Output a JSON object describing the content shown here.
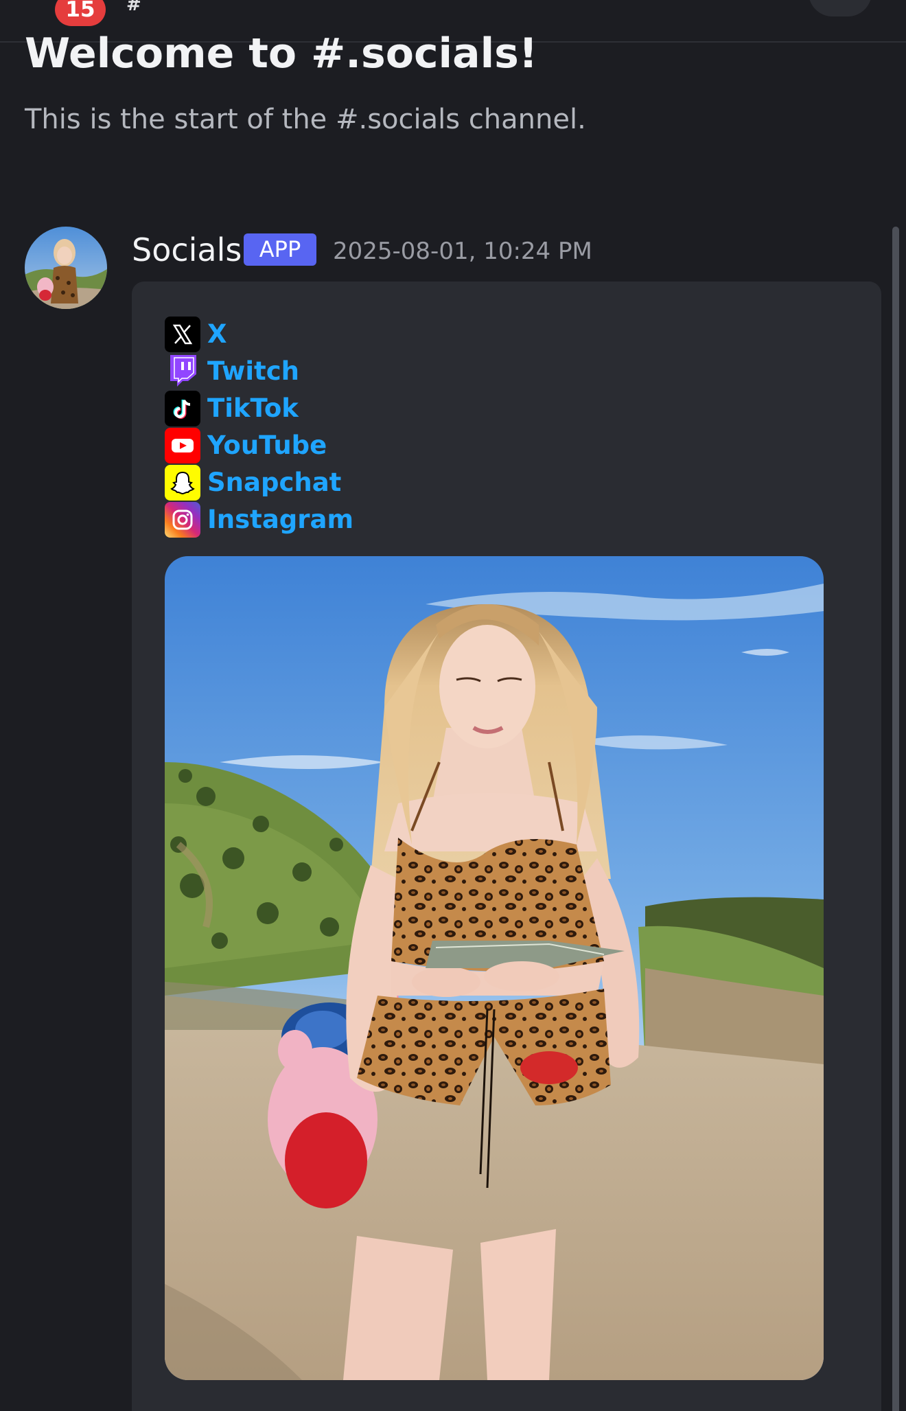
{
  "topbar": {
    "unread_count": "15",
    "channel_hash": "#"
  },
  "welcome": {
    "title": "Welcome to #.socials!",
    "subtitle": "This is the start of the #.socials channel."
  },
  "message": {
    "author": "Socials",
    "tag": "APP",
    "timestamp": "2025-08-01, 10:24 PM",
    "avatar_icon": "avatar-photo"
  },
  "embed": {
    "links": [
      {
        "label": "X",
        "icon": "x-logo-icon",
        "color": "#000000"
      },
      {
        "label": "Twitch",
        "icon": "twitch-logo-icon",
        "color": "#9146ff"
      },
      {
        "label": "TikTok",
        "icon": "tiktok-logo-icon",
        "color": "#000000"
      },
      {
        "label": "YouTube",
        "icon": "youtube-logo-icon",
        "color": "#ff0000"
      },
      {
        "label": "Snapchat",
        "icon": "snapchat-logo-icon",
        "color": "#fffc00"
      },
      {
        "label": "Instagram",
        "icon": "instagram-logo-icon",
        "color": "#c13584"
      }
    ],
    "image_icon": "embed-photo"
  },
  "colors": {
    "background": "#1c1d22",
    "embed": "#2a2c32",
    "link": "#1fa5ff",
    "app_tag": "#5865f2",
    "badge": "#e53d3d"
  }
}
